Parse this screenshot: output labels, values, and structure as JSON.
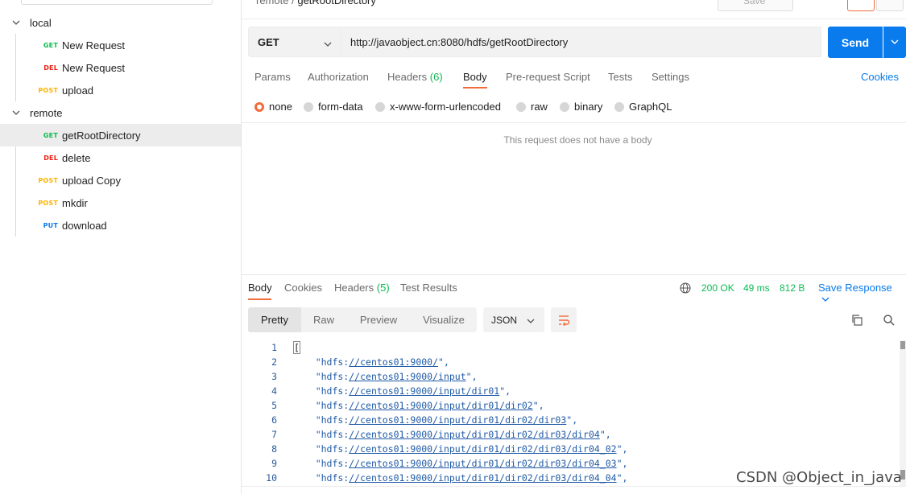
{
  "breadcrumb": {
    "parent": "remote",
    "separator": "/",
    "current": "getRootDirectory"
  },
  "header": {
    "save_label": "Save"
  },
  "sidebar": {
    "folders": [
      {
        "label": "local"
      },
      {
        "label": "remote"
      }
    ],
    "items": [
      {
        "method": "GET",
        "label": "New Request"
      },
      {
        "method": "DEL",
        "label": "New Request"
      },
      {
        "method": "POST",
        "label": "upload"
      },
      {
        "method": "GET",
        "label": "getRootDirectory"
      },
      {
        "method": "DEL",
        "label": "delete"
      },
      {
        "method": "POST",
        "label": "upload Copy"
      },
      {
        "method": "POST",
        "label": "mkdir"
      },
      {
        "method": "PUT",
        "label": "download"
      }
    ]
  },
  "request": {
    "method": "GET",
    "url": "http://javaobject.cn:8080/hdfs/getRootDirectory",
    "send_label": "Send",
    "tabs": {
      "params": "Params",
      "authorization": "Authorization",
      "headers": "Headers",
      "headers_count": "(6)",
      "body": "Body",
      "prerequest": "Pre-request Script",
      "tests": "Tests",
      "settings": "Settings"
    },
    "cookies_label": "Cookies",
    "body_types": [
      "none",
      "form-data",
      "x-www-form-urlencoded",
      "raw",
      "binary",
      "GraphQL"
    ],
    "no_body_text": "This request does not have a body"
  },
  "response": {
    "tabs": {
      "body": "Body",
      "cookies": "Cookies",
      "headers": "Headers",
      "headers_count": "(5)",
      "test_results": "Test Results"
    },
    "status": "200 OK",
    "time": "49 ms",
    "size": "812 B",
    "save_label": "Save Response",
    "views": [
      "Pretty",
      "Raw",
      "Preview",
      "Visualize"
    ],
    "format": "JSON",
    "lines": [
      {
        "n": "1",
        "open": "[",
        "pre": "",
        "link": "",
        "post": ""
      },
      {
        "n": "2",
        "open": "",
        "pre": "    \"hdfs:",
        "link": "//centos01:9000/",
        "post": "\","
      },
      {
        "n": "3",
        "open": "",
        "pre": "    \"hdfs:",
        "link": "//centos01:9000/input",
        "post": "\","
      },
      {
        "n": "4",
        "open": "",
        "pre": "    \"hdfs:",
        "link": "//centos01:9000/input/dir01",
        "post": "\","
      },
      {
        "n": "5",
        "open": "",
        "pre": "    \"hdfs:",
        "link": "//centos01:9000/input/dir01/dir02",
        "post": "\","
      },
      {
        "n": "6",
        "open": "",
        "pre": "    \"hdfs:",
        "link": "//centos01:9000/input/dir01/dir02/dir03",
        "post": "\","
      },
      {
        "n": "7",
        "open": "",
        "pre": "    \"hdfs:",
        "link": "//centos01:9000/input/dir01/dir02/dir03/dir04",
        "post": "\","
      },
      {
        "n": "8",
        "open": "",
        "pre": "    \"hdfs:",
        "link": "//centos01:9000/input/dir01/dir02/dir03/dir04_02",
        "post": "\","
      },
      {
        "n": "9",
        "open": "",
        "pre": "    \"hdfs:",
        "link": "//centos01:9000/input/dir01/dir02/dir03/dir04_03",
        "post": "\","
      },
      {
        "n": "10",
        "open": "",
        "pre": "    \"hdfs:",
        "link": "//centos01:9000/input/dir01/dir02/dir03/dir04_04",
        "post": "\","
      }
    ]
  },
  "watermark": "CSDN @Object_in_java",
  "colors": {
    "accent": "#f26b3a",
    "primary": "#097bed",
    "get": "#0cbb52",
    "delete": "#eb2013",
    "post": "#ffb400",
    "put": "#097bed"
  }
}
